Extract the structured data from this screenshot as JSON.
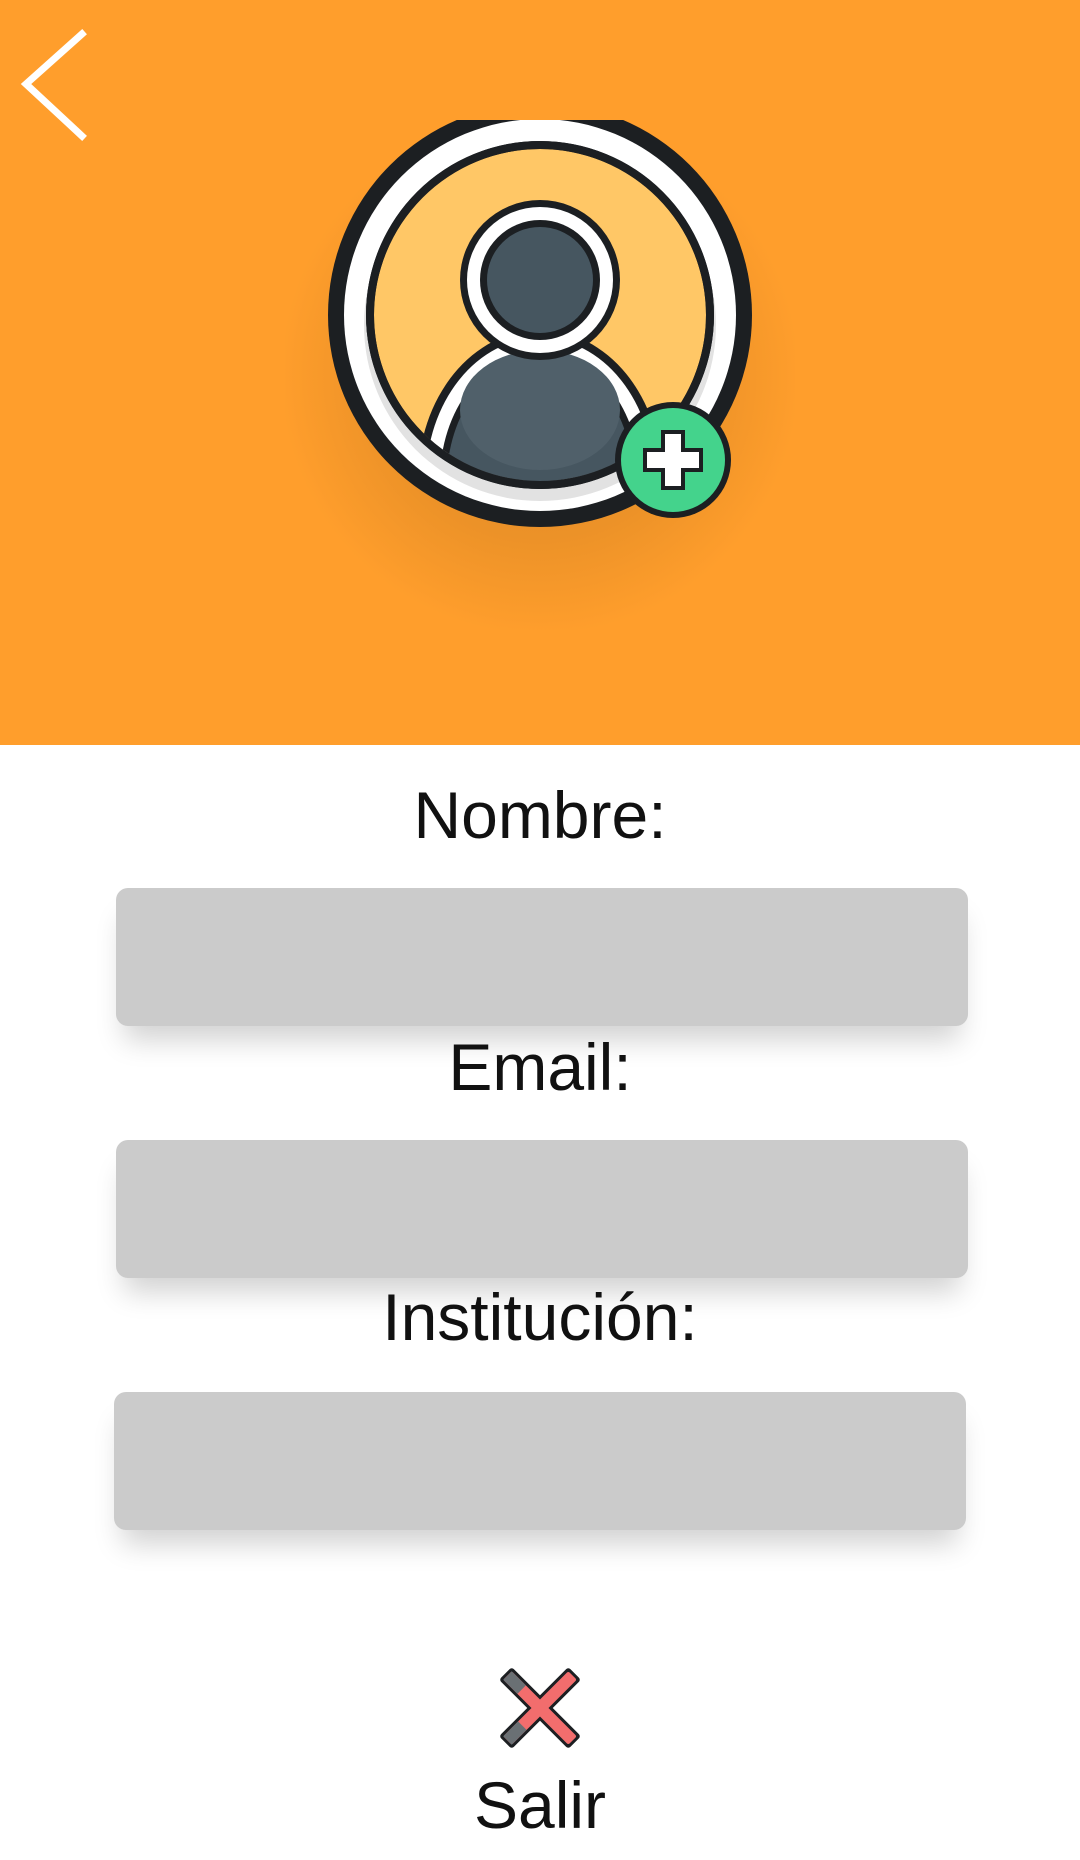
{
  "colors": {
    "header_background": "#ff9e2c",
    "input_background": "#cbcbcb",
    "avatar_fill": "#ffc766",
    "person_fill": "#465660",
    "add_badge": "#44d38c",
    "exit_icon": "#f26d6d"
  },
  "header": {
    "back_icon": "chevron-left-icon",
    "avatar_icon": "user-add-icon"
  },
  "form": {
    "name_label": "Nombre:",
    "name_value": "",
    "email_label": "Email:",
    "email_value": "",
    "institution_label": "Institución:",
    "institution_value": ""
  },
  "exit": {
    "icon": "close-x-icon",
    "label": "Salir"
  }
}
